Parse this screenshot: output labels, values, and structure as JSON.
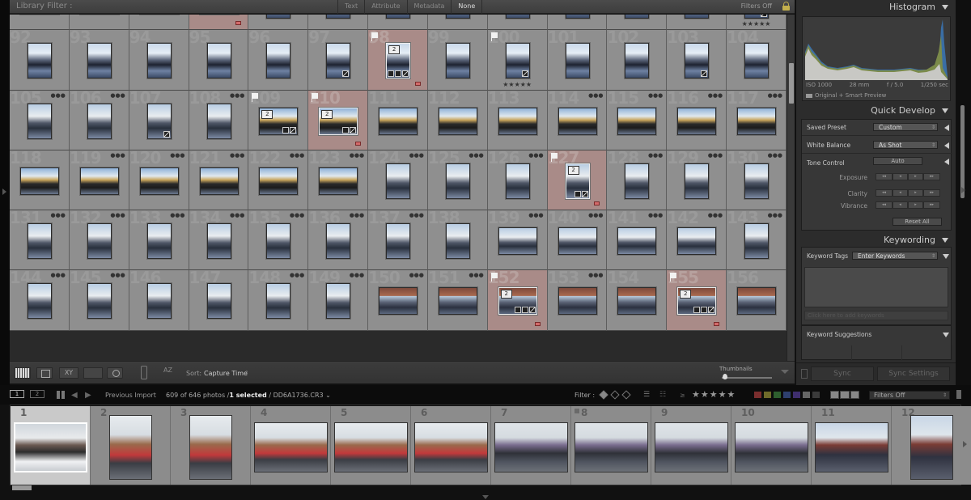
{
  "filter_bar": {
    "title": "Library Filter :",
    "tabs": [
      {
        "label": "Text",
        "active": false
      },
      {
        "label": "Attribute",
        "active": false
      },
      {
        "label": "Metadata",
        "active": false
      },
      {
        "label": "None",
        "active": true
      }
    ],
    "preset": "Filters Off"
  },
  "grid": {
    "cells": [
      {
        "n": "",
        "o": "p",
        "ph": "ph-b",
        "land": true
      },
      {
        "n": "",
        "o": "l",
        "ph": "ph-b"
      },
      {
        "n": "",
        "o": "l",
        "ph": "ph-b"
      },
      {
        "n": "",
        "o": "l",
        "ph": "ph-b",
        "sel": true,
        "stack": "2",
        "badges": [
          "map",
          "crop",
          "edit"
        ],
        "label": "red"
      },
      {
        "n": "",
        "o": "p",
        "ph": "ph-a"
      },
      {
        "n": "",
        "o": "p",
        "ph": "ph-a"
      },
      {
        "n": "",
        "o": "p",
        "ph": "ph-a"
      },
      {
        "n": "",
        "o": "p",
        "ph": "ph-a"
      },
      {
        "n": "",
        "o": "p",
        "ph": "ph-a"
      },
      {
        "n": "",
        "o": "p",
        "ph": "ph-a"
      },
      {
        "n": "",
        "o": "p",
        "ph": "ph-a"
      },
      {
        "n": "",
        "o": "p",
        "ph": "ph-a"
      },
      {
        "n": "",
        "o": "p",
        "ph": "ph-a",
        "badges": [
          "edit"
        ],
        "stars": "★★★★★"
      },
      {
        "n": "92",
        "o": "p",
        "ph": "ph-a"
      },
      {
        "n": "93",
        "o": "p",
        "ph": "ph-a"
      },
      {
        "n": "94",
        "o": "p",
        "ph": "ph-a"
      },
      {
        "n": "95",
        "o": "p",
        "ph": "ph-a"
      },
      {
        "n": "96",
        "o": "p",
        "ph": "ph-a"
      },
      {
        "n": "97",
        "o": "p",
        "ph": "ph-a",
        "badges": [
          "edit"
        ]
      },
      {
        "n": "98",
        "o": "p",
        "ph": "ph-a",
        "sel": true,
        "flag": true,
        "stack": "2",
        "badges": [
          "map",
          "crop",
          "edit"
        ],
        "label": "red"
      },
      {
        "n": "99",
        "o": "p",
        "ph": "ph-a"
      },
      {
        "n": "100",
        "o": "p",
        "ph": "ph-a",
        "flag": true,
        "badges": [
          "edit"
        ],
        "stars": "★★★★★"
      },
      {
        "n": "101",
        "o": "p",
        "ph": "ph-a"
      },
      {
        "n": "102",
        "o": "p",
        "ph": "ph-a"
      },
      {
        "n": "103",
        "o": "p",
        "ph": "ph-a",
        "badges": [
          "edit"
        ]
      },
      {
        "n": "104",
        "o": "p",
        "ph": "ph-a"
      },
      {
        "n": "105",
        "o": "p",
        "ph": "ph-c",
        "dots": true
      },
      {
        "n": "106",
        "o": "p",
        "ph": "ph-c",
        "dots": true
      },
      {
        "n": "107",
        "o": "p",
        "ph": "ph-c",
        "badges": [
          "edit"
        ]
      },
      {
        "n": "108",
        "o": "p",
        "ph": "ph-c",
        "dots": true
      },
      {
        "n": "109",
        "o": "l",
        "ph": "ph-b",
        "flag": true,
        "stack": "2",
        "badges": [
          "map",
          "edit"
        ]
      },
      {
        "n": "110",
        "o": "l",
        "ph": "ph-b",
        "sel": true,
        "flag": true,
        "stack": "2",
        "badges": [
          "map",
          "edit"
        ],
        "label": "red"
      },
      {
        "n": "111",
        "o": "l",
        "ph": "ph-b"
      },
      {
        "n": "112",
        "o": "l",
        "ph": "ph-b"
      },
      {
        "n": "113",
        "o": "l",
        "ph": "ph-b"
      },
      {
        "n": "114",
        "o": "l",
        "ph": "ph-b",
        "dots": true
      },
      {
        "n": "115",
        "o": "l",
        "ph": "ph-b",
        "dots": true
      },
      {
        "n": "116",
        "o": "l",
        "ph": "ph-b",
        "dots": true
      },
      {
        "n": "117",
        "o": "l",
        "ph": "ph-b",
        "dots": true
      },
      {
        "n": "118",
        "o": "l",
        "ph": "ph-b"
      },
      {
        "n": "119",
        "o": "l",
        "ph": "ph-b",
        "dots": true
      },
      {
        "n": "120",
        "o": "l",
        "ph": "ph-b",
        "dots": true
      },
      {
        "n": "121",
        "o": "l",
        "ph": "ph-b",
        "dots": true
      },
      {
        "n": "122",
        "o": "l",
        "ph": "ph-b",
        "dots": true
      },
      {
        "n": "123",
        "o": "l",
        "ph": "ph-b",
        "dots": true
      },
      {
        "n": "124",
        "o": "p",
        "ph": "ph-c",
        "dots": true
      },
      {
        "n": "125",
        "o": "p",
        "ph": "ph-c",
        "dots": true
      },
      {
        "n": "126",
        "o": "p",
        "ph": "ph-c",
        "dots": true
      },
      {
        "n": "127",
        "o": "p",
        "ph": "ph-c",
        "sel": true,
        "flag": true,
        "stack": "2",
        "badges": [
          "map",
          "edit"
        ],
        "label": "red"
      },
      {
        "n": "128",
        "o": "p",
        "ph": "ph-c",
        "dots": true
      },
      {
        "n": "129",
        "o": "p",
        "ph": "ph-c",
        "dots": true
      },
      {
        "n": "130",
        "o": "p",
        "ph": "ph-c",
        "dots": true
      },
      {
        "n": "131",
        "o": "p",
        "ph": "ph-c",
        "dots": true
      },
      {
        "n": "132",
        "o": "p",
        "ph": "ph-c",
        "dots": true
      },
      {
        "n": "133",
        "o": "p",
        "ph": "ph-c",
        "dots": true
      },
      {
        "n": "134",
        "o": "p",
        "ph": "ph-c",
        "dots": true
      },
      {
        "n": "135",
        "o": "p",
        "ph": "ph-c",
        "dots": true
      },
      {
        "n": "136",
        "o": "p",
        "ph": "ph-c",
        "dots": true
      },
      {
        "n": "137",
        "o": "p",
        "ph": "ph-c",
        "dots": true
      },
      {
        "n": "138",
        "o": "p",
        "ph": "ph-c"
      },
      {
        "n": "139",
        "o": "l",
        "ph": "ph-c",
        "dots": true
      },
      {
        "n": "140",
        "o": "l",
        "ph": "ph-c",
        "dots": true
      },
      {
        "n": "141",
        "o": "l",
        "ph": "ph-c",
        "dots": true
      },
      {
        "n": "142",
        "o": "l",
        "ph": "ph-c",
        "dots": true
      },
      {
        "n": "143",
        "o": "p",
        "ph": "ph-c",
        "dots": true
      },
      {
        "n": "144",
        "o": "p",
        "ph": "ph-c",
        "dots": true
      },
      {
        "n": "145",
        "o": "p",
        "ph": "ph-c",
        "dots": true
      },
      {
        "n": "146",
        "o": "p",
        "ph": "ph-c"
      },
      {
        "n": "147",
        "o": "p",
        "ph": "ph-c"
      },
      {
        "n": "148",
        "o": "p",
        "ph": "ph-c",
        "dots": true
      },
      {
        "n": "149",
        "o": "p",
        "ph": "ph-c",
        "dots": true
      },
      {
        "n": "150",
        "o": "l",
        "ph": "ph-d",
        "dots": true
      },
      {
        "n": "151",
        "o": "l",
        "ph": "ph-d",
        "dots": true
      },
      {
        "n": "152",
        "o": "l",
        "ph": "ph-d",
        "sel": true,
        "flag": true,
        "stack": "2",
        "badges": [
          "map",
          "crop",
          "edit"
        ],
        "label": "red"
      },
      {
        "n": "153",
        "o": "l",
        "ph": "ph-d",
        "dots": true
      },
      {
        "n": "154",
        "o": "l",
        "ph": "ph-d"
      },
      {
        "n": "155",
        "o": "l",
        "ph": "ph-d",
        "sel": true,
        "flag": true,
        "stack": "2",
        "badges": [
          "map",
          "crop",
          "edit"
        ],
        "label": "red"
      },
      {
        "n": "156",
        "o": "l",
        "ph": "ph-d"
      }
    ]
  },
  "toolbar": {
    "view_grid": "Grid view",
    "view_loupe": "Loupe view",
    "view_compare": "XY",
    "view_survey": "Survey view",
    "view_people": "People view",
    "sort_icon": "AZ",
    "sort_label": "Sort:",
    "sort_value": "Capture Time",
    "thumbnails_label": "Thumbnails",
    "thumbnail_size": 0.05
  },
  "right_panel": {
    "histogram": {
      "title": "Histogram",
      "iso": "ISO 1000",
      "focal": "28 mm",
      "aperture": "f / 5.0",
      "shutter": "1/250 sec",
      "preview": "Original + Smart Preview"
    },
    "quick_develop": {
      "title": "Quick Develop",
      "saved_preset_label": "Saved Preset",
      "saved_preset_value": "Custom",
      "white_balance_label": "White Balance",
      "white_balance_value": "As Shot",
      "tone_control_label": "Tone Control",
      "auto_label": "Auto",
      "exposure_label": "Exposure",
      "clarity_label": "Clarity",
      "vibrance_label": "Vibrance",
      "step_labels": [
        "◂◂",
        "◂",
        "▸",
        "▸▸"
      ],
      "reset_label": "Reset All"
    },
    "keywording": {
      "title": "Keywording",
      "tags_label": "Keyword Tags",
      "tags_value": "Enter Keywords",
      "add_placeholder": "Click here to add keywords",
      "suggestions_label": "Keyword Suggestions"
    },
    "sync": {
      "sync_label": "Sync",
      "sync_settings_label": "Sync Settings"
    }
  },
  "secondary_bar": {
    "monitor1": "1",
    "monitor2": "2",
    "source": "Previous Import",
    "count": "609 of 646 photos /",
    "selected": "1 selected",
    "filename": "/ DD6A1736.CR3 ⌄",
    "filter_label": "Filter :",
    "ge": "≥",
    "stars": "★★★★★",
    "color_labels": [
      "#7a2e2e",
      "#6f6a2a",
      "#2e5e2e",
      "#2e3f6e",
      "#3e2e6e",
      "#666666",
      "#3a3a3a"
    ],
    "filter_preset": "Filters Off"
  },
  "filmstrip": {
    "items": [
      {
        "n": "1",
        "o": "l",
        "ph": "fv1",
        "active": true
      },
      {
        "n": "2",
        "o": "p",
        "ph": "fv2"
      },
      {
        "n": "3",
        "o": "p",
        "ph": "fv2"
      },
      {
        "n": "4",
        "o": "l",
        "ph": "fv2"
      },
      {
        "n": "5",
        "o": "l",
        "ph": "fv2"
      },
      {
        "n": "6",
        "o": "l",
        "ph": "fv2"
      },
      {
        "n": "7",
        "o": "l",
        "ph": "fv3"
      },
      {
        "n": "8",
        "o": "l",
        "ph": "fv3",
        "flag": true
      },
      {
        "n": "9",
        "o": "l",
        "ph": "fv3"
      },
      {
        "n": "10",
        "o": "l",
        "ph": "fv3"
      },
      {
        "n": "11",
        "o": "l",
        "ph": "fv4"
      },
      {
        "n": "12",
        "o": "p",
        "ph": "fv4"
      }
    ]
  }
}
